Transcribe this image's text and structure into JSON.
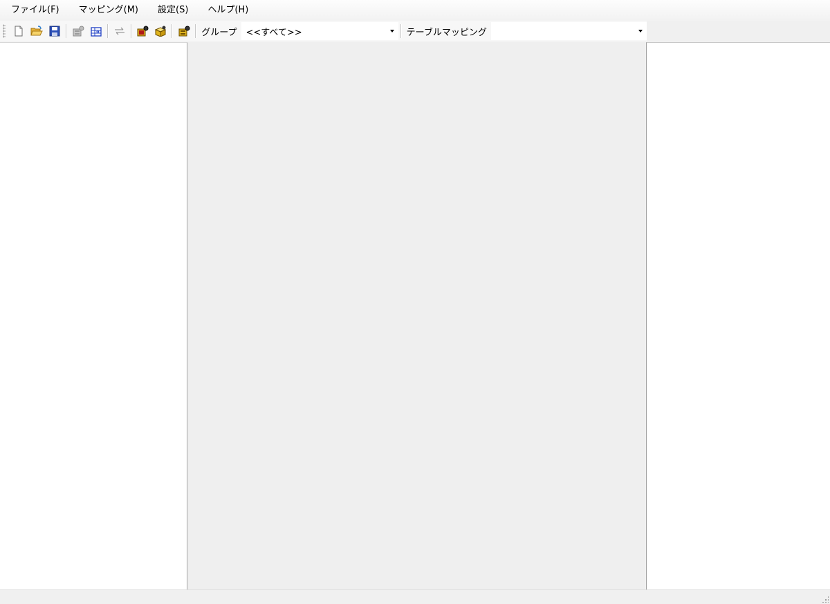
{
  "menu": {
    "items": [
      "ファイル(F)",
      "マッピング(M)",
      "設定(S)",
      "ヘルプ(H)"
    ]
  },
  "toolbar": {
    "buttons": [
      "new-file-icon",
      "open-folder-icon",
      "save-icon",
      "properties-icon",
      "table-icon",
      "connect-arrows-icon",
      "red-gear-icon",
      "yellow-box-icon",
      "settings-gear-icon"
    ],
    "group_label": "グループ",
    "group_value": "<<すべて>>",
    "table_mapping_label": "テーブルマッピング",
    "table_mapping_value": ""
  }
}
